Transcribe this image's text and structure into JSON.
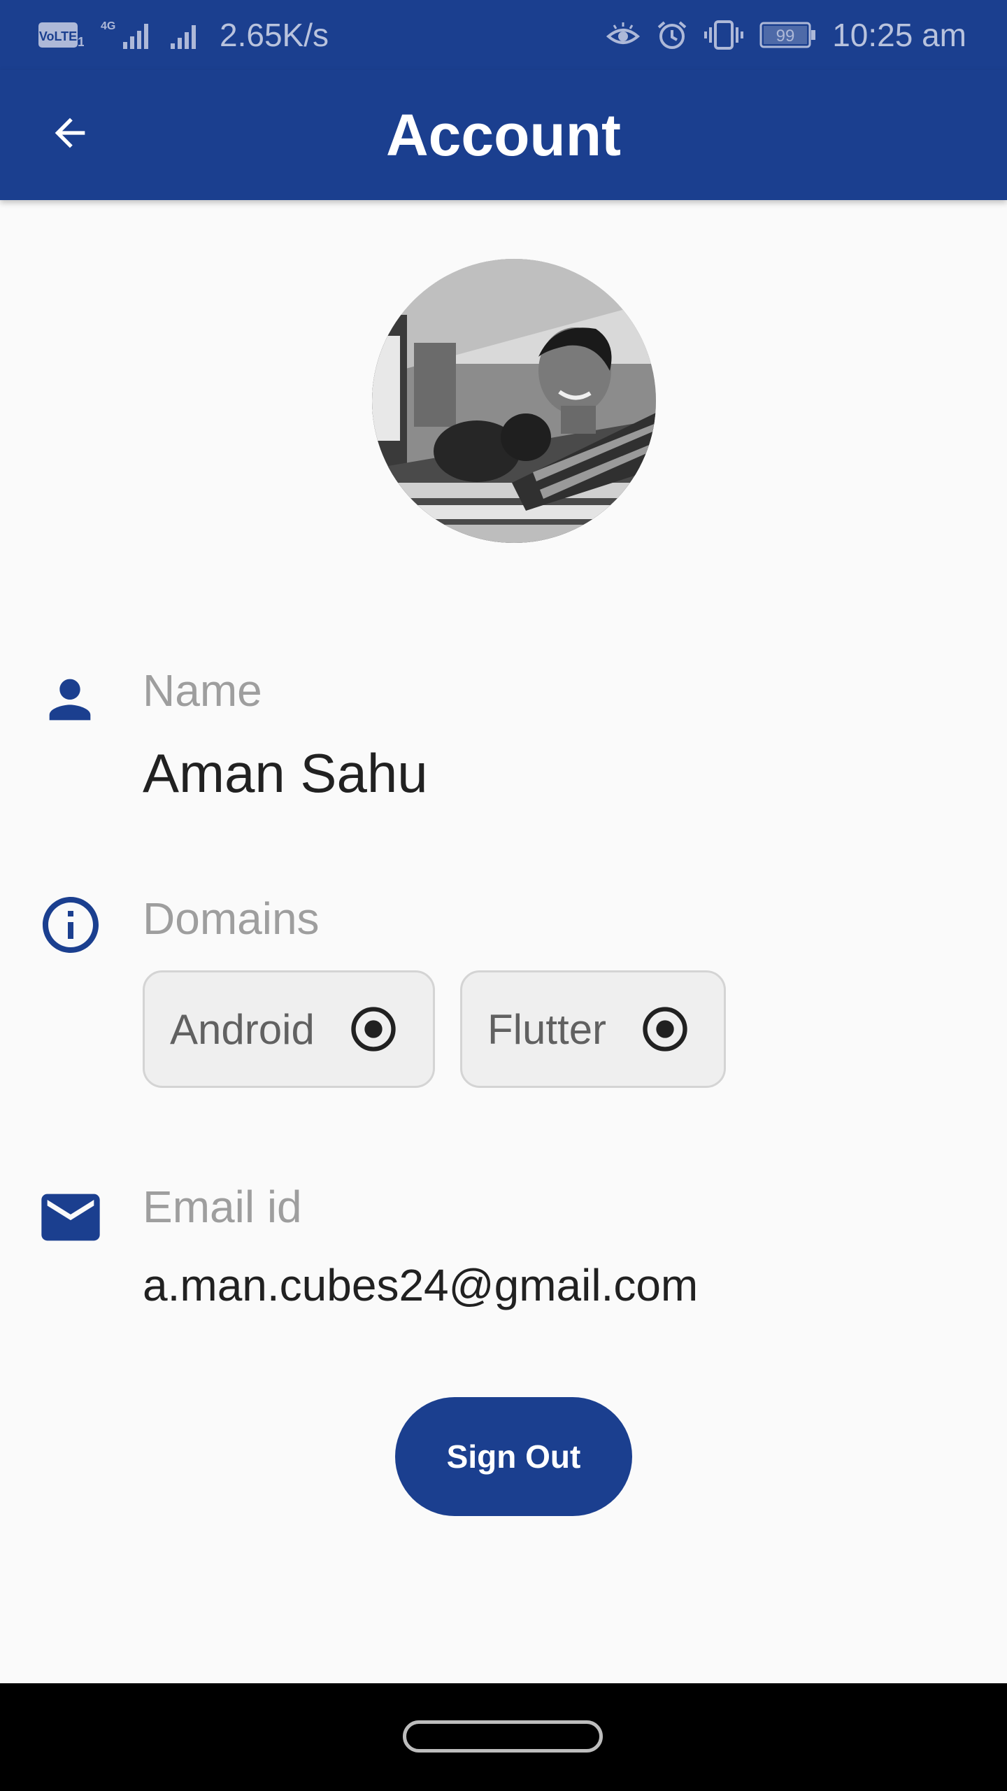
{
  "status_bar": {
    "volte_text": "VoLTE",
    "sim_slot": "1",
    "network_type": "4G",
    "speed": "2.65K/s",
    "battery": "99",
    "time": "10:25 am"
  },
  "app_bar": {
    "title": "Account"
  },
  "profile": {
    "name_label": "Name",
    "name_value": "Aman Sahu",
    "domains_label": "Domains",
    "domains": [
      {
        "label": "Android"
      },
      {
        "label": "Flutter"
      }
    ],
    "email_label": "Email id",
    "email_value": "a.man.cubes24@gmail.com"
  },
  "actions": {
    "sign_out_label": "Sign Out"
  },
  "colors": {
    "primary": "#1b3f8f",
    "background": "#fafafa",
    "label_grey": "#9e9e9e",
    "text_dark": "#212121"
  },
  "icons": {
    "back": "arrow-back-icon",
    "name": "person-icon",
    "domains": "info-icon",
    "email": "mail-icon",
    "chip": "radio-selected-icon"
  }
}
